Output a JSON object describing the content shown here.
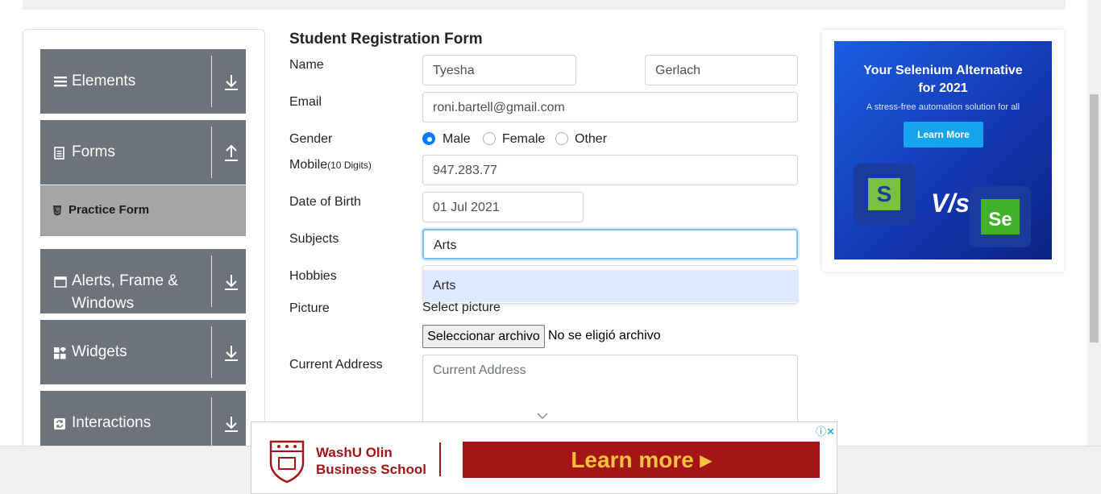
{
  "sidebar": {
    "groups": [
      {
        "label": "Elements",
        "icon": "hamburger-icon",
        "arrow": "download-arrow-icon"
      },
      {
        "label": "Forms",
        "icon": "document-icon",
        "arrow": "upload-arrow-icon"
      },
      {
        "label": "Alerts, Frame &",
        "label2": "Windows",
        "icon": "window-icon",
        "arrow": "download-arrow-icon"
      },
      {
        "label": "Widgets",
        "icon": "widgets-icon",
        "arrow": "download-arrow-icon"
      },
      {
        "label": "Interactions",
        "icon": "refresh-icon",
        "arrow": "download-arrow-icon"
      }
    ],
    "active_item": {
      "label": "Practice Form",
      "icon": "html5-icon"
    }
  },
  "form": {
    "title": "Student Registration Form",
    "labels": {
      "name": "Name",
      "email": "Email",
      "gender": "Gender",
      "mobile": "Mobile",
      "mobile_hint": "(10 Digits)",
      "dob": "Date of Birth",
      "subjects": "Subjects",
      "hobbies": "Hobbies",
      "picture": "Picture",
      "address": "Current Address"
    },
    "first_name": "Tyesha",
    "last_name": "Gerlach",
    "email": "roni.bartell@gmail.com",
    "gender_options": [
      "Male",
      "Female",
      "Other"
    ],
    "gender_selected": "Male",
    "mobile": "947.283.77",
    "dob": "01 Jul 2021",
    "subjects_value": "Arts",
    "subjects_suggestion": "Arts",
    "select_picture": "Select picture",
    "file_button": "Seleccionar archivo",
    "file_status": "No se eligió archivo",
    "address_placeholder": "Current Address"
  },
  "right_ad": {
    "title_line1": "Your Selenium Alternative",
    "title_line2": "for 2021",
    "subtitle": "A stress-free automation solution for all",
    "button": "Learn More",
    "vs": "V/s",
    "logo1": "S",
    "logo2": "Se",
    "colors": {
      "bg": "#1439b5",
      "button": "#17a4ef"
    }
  },
  "bottom_ad": {
    "line1": "WashU Olin",
    "line2": "Business School",
    "button": "Learn more ▸",
    "colors": {
      "brand": "#a51417",
      "button_text": "#f5c23e"
    }
  }
}
